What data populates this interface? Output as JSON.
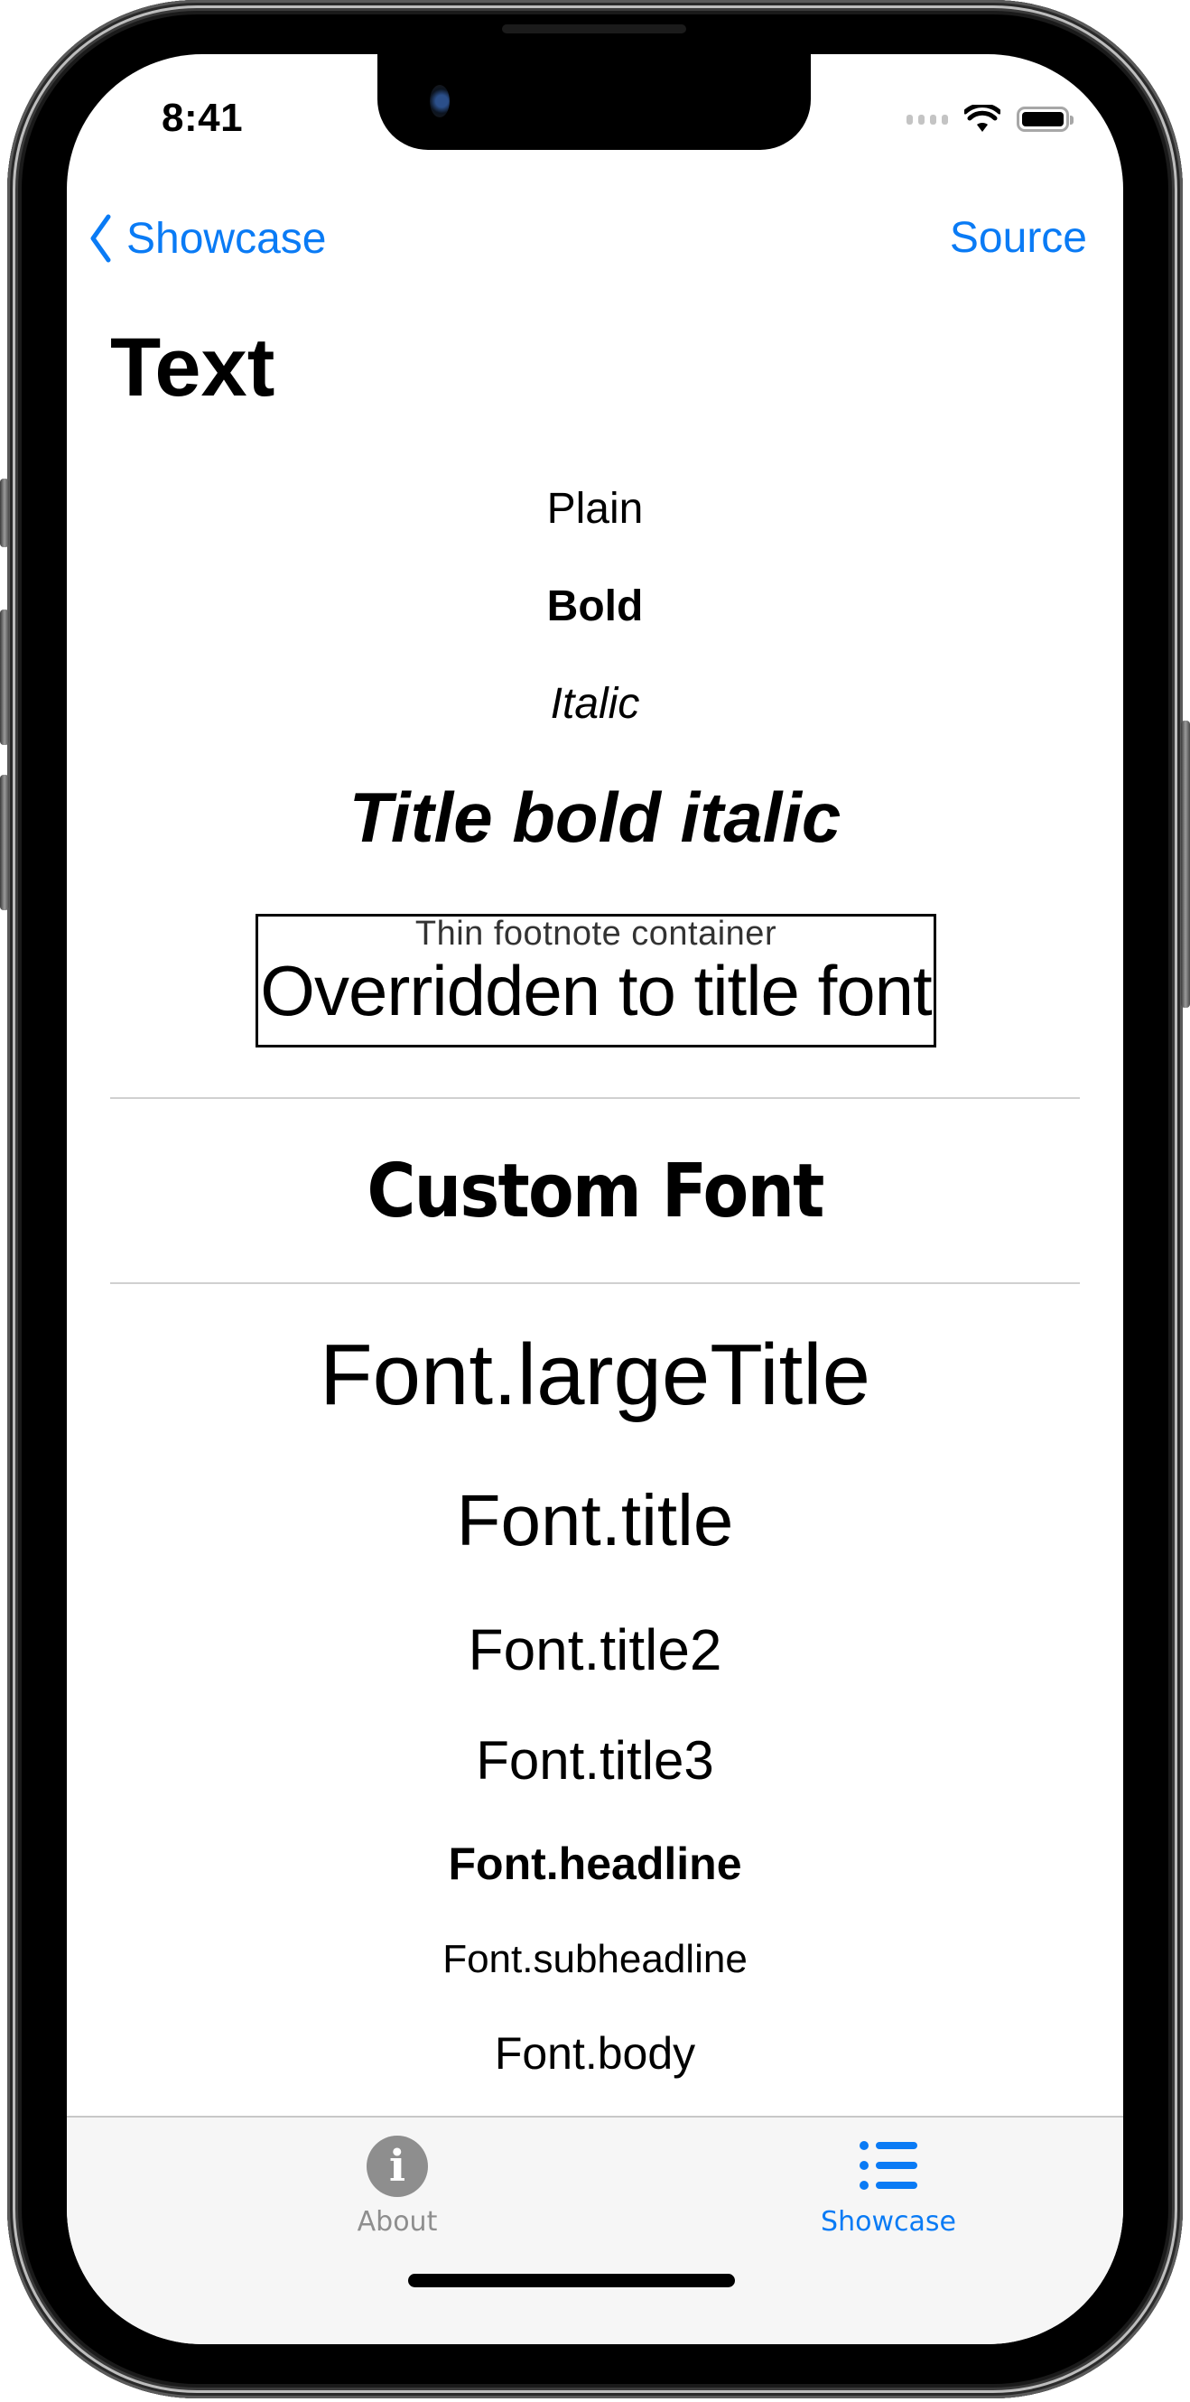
{
  "status_bar": {
    "time": "8:41",
    "icons": [
      "cellular-signal-icon",
      "wifi-icon",
      "battery-icon"
    ]
  },
  "nav": {
    "back_label": "Showcase",
    "back_icon": "chevron-left-icon",
    "right_label": "Source",
    "title": "Text",
    "accent_color": "#0A7BF5"
  },
  "samples": {
    "plain": "Plain",
    "bold": "Bold",
    "italic": "Italic",
    "title_bold_italic": "Title bold italic",
    "container_footnote": "Thin footnote container",
    "container_override": "Overridden to title font",
    "custom_font": "Custom Font"
  },
  "font_styles": [
    "Font.largeTitle",
    "Font.title",
    "Font.title2",
    "Font.title3",
    "Font.headline",
    "Font.subheadline",
    "Font.body"
  ],
  "tab_bar": {
    "tabs": [
      {
        "label": "About",
        "icon": "info-circle-icon",
        "selected": false
      },
      {
        "label": "Showcase",
        "icon": "list-bullet-icon",
        "selected": true
      }
    ],
    "selected_color": "#0A7BF5",
    "unselected_color": "#8E8E8E"
  }
}
